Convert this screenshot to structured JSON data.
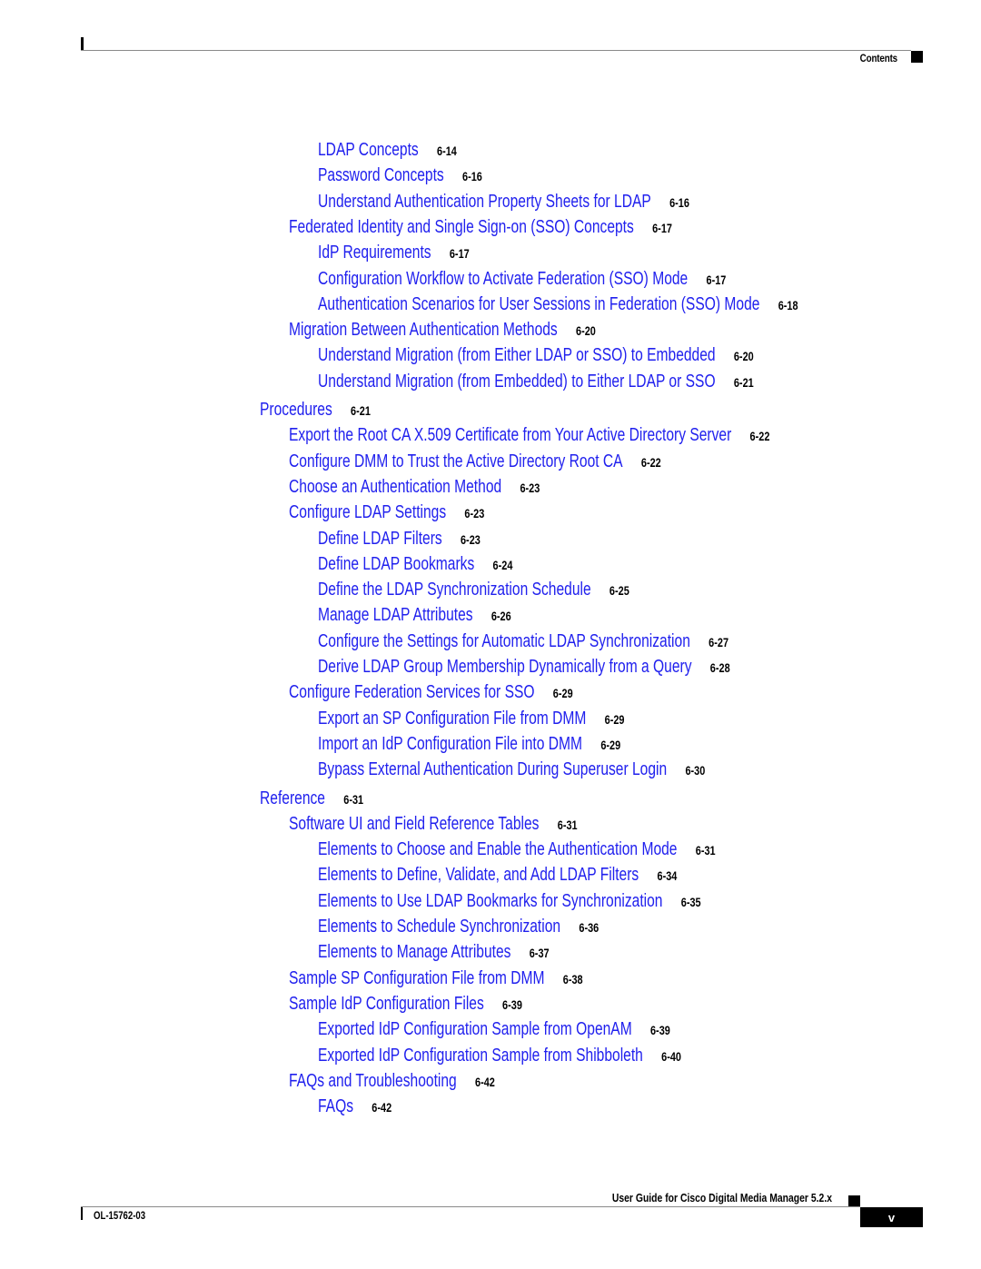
{
  "header": {
    "section_title": "Contents"
  },
  "toc": {
    "link_color": "#2020ee",
    "entries": [
      {
        "level": 3,
        "title": "LDAP Concepts",
        "page": "6-14"
      },
      {
        "level": 3,
        "title": "Password Concepts",
        "page": "6-16"
      },
      {
        "level": 3,
        "title": "Understand Authentication Property Sheets for LDAP",
        "page": "6-16"
      },
      {
        "level": 2,
        "title": "Federated Identity and Single Sign-on (SSO) Concepts",
        "page": "6-17"
      },
      {
        "level": 3,
        "title": "IdP Requirements",
        "page": "6-17"
      },
      {
        "level": 3,
        "title": "Configuration Workflow to Activate Federation (SSO) Mode",
        "page": "6-17"
      },
      {
        "level": 3,
        "title": "Authentication Scenarios for User Sessions in Federation (SSO) Mode",
        "page": "6-18"
      },
      {
        "level": 2,
        "title": "Migration Between Authentication Methods",
        "page": "6-20"
      },
      {
        "level": 3,
        "title": "Understand Migration (from Either LDAP or SSO) to Embedded",
        "page": "6-20"
      },
      {
        "level": 3,
        "title": "Understand Migration (from Embedded) to Either LDAP or SSO",
        "page": "6-21"
      },
      {
        "level": 1,
        "title": "Procedures",
        "page": "6-21"
      },
      {
        "level": 2,
        "title": "Export the Root CA X.509 Certificate from Your Active Directory Server",
        "page": "6-22"
      },
      {
        "level": 2,
        "title": "Configure DMM to Trust the Active Directory Root CA",
        "page": "6-22"
      },
      {
        "level": 2,
        "title": "Choose an Authentication Method",
        "page": "6-23"
      },
      {
        "level": 2,
        "title": "Configure LDAP Settings",
        "page": "6-23"
      },
      {
        "level": 3,
        "title": "Define LDAP Filters",
        "page": "6-23"
      },
      {
        "level": 3,
        "title": "Define LDAP Bookmarks",
        "page": "6-24"
      },
      {
        "level": 3,
        "title": "Define the LDAP Synchronization Schedule",
        "page": "6-25"
      },
      {
        "level": 3,
        "title": "Manage LDAP Attributes",
        "page": "6-26"
      },
      {
        "level": 3,
        "title": "Configure the Settings for Automatic LDAP Synchronization",
        "page": "6-27"
      },
      {
        "level": 3,
        "title": "Derive LDAP Group Membership Dynamically from a Query",
        "page": "6-28"
      },
      {
        "level": 2,
        "title": "Configure Federation Services for SSO",
        "page": "6-29"
      },
      {
        "level": 3,
        "title": "Export an SP Configuration File from DMM",
        "page": "6-29"
      },
      {
        "level": 3,
        "title": "Import an IdP Configuration File into DMM",
        "page": "6-29"
      },
      {
        "level": 3,
        "title": "Bypass External Authentication During Superuser Login",
        "page": "6-30"
      },
      {
        "level": 1,
        "title": "Reference",
        "page": "6-31"
      },
      {
        "level": 2,
        "title": "Software UI and Field Reference Tables",
        "page": "6-31"
      },
      {
        "level": 3,
        "title": "Elements to Choose and Enable the Authentication Mode",
        "page": "6-31"
      },
      {
        "level": 3,
        "title": "Elements to Define, Validate, and Add LDAP Filters",
        "page": "6-34"
      },
      {
        "level": 3,
        "title": "Elements to Use LDAP Bookmarks for Synchronization",
        "page": "6-35"
      },
      {
        "level": 3,
        "title": "Elements to Schedule Synchronization",
        "page": "6-36"
      },
      {
        "level": 3,
        "title": "Elements to Manage Attributes",
        "page": "6-37"
      },
      {
        "level": 2,
        "title": "Sample SP Configuration File from DMM",
        "page": "6-38"
      },
      {
        "level": 2,
        "title": "Sample IdP Configuration Files",
        "page": "6-39"
      },
      {
        "level": 3,
        "title": "Exported IdP Configuration Sample from OpenAM",
        "page": "6-39"
      },
      {
        "level": 3,
        "title": "Exported IdP Configuration Sample from Shibboleth",
        "page": "6-40"
      },
      {
        "level": 2,
        "title": "FAQs and Troubleshooting",
        "page": "6-42"
      },
      {
        "level": 3,
        "title": "FAQs",
        "page": "6-42"
      }
    ]
  },
  "footer": {
    "guide_title": "User Guide for Cisco Digital Media Manager 5.2.x",
    "doc_id": "OL-15762-03",
    "page_number": "v"
  }
}
